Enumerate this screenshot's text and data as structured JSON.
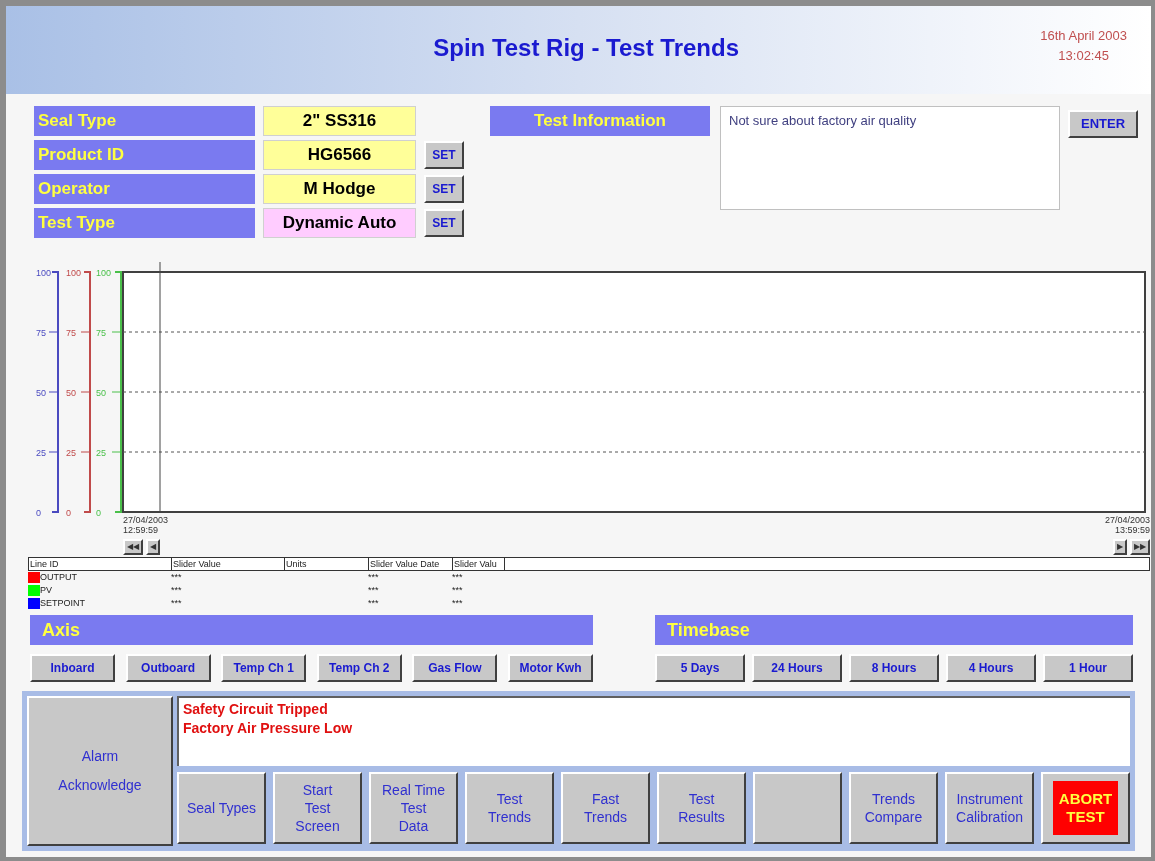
{
  "header": {
    "title": "Spin Test Rig - Test Trends",
    "date": "16th April 2003",
    "time": "13:02:45"
  },
  "fields": [
    {
      "label": "Seal Type",
      "value": "2\" SS316",
      "kind": "normal"
    },
    {
      "label": "Product ID",
      "value": "HG6566",
      "kind": "normal",
      "button": "SET"
    },
    {
      "label": "Operator",
      "value": "M Hodge",
      "kind": "normal",
      "button": "SET"
    },
    {
      "label": "Test Type",
      "value": "Dynamic Auto",
      "kind": "special",
      "button": "SET"
    }
  ],
  "test_information": {
    "label": "Test Information",
    "value": "Not sure about factory air quality",
    "button": "ENTER"
  },
  "trend_chart": {
    "axes": [
      {
        "color": "#4a4ac0",
        "ticks": [
          "100",
          "75",
          "50",
          "25",
          "0"
        ]
      },
      {
        "color": "#c04a4a",
        "ticks": [
          "100",
          "75",
          "50",
          "25",
          "0"
        ]
      },
      {
        "color": "#4ac04a",
        "ticks": [
          "100",
          "75",
          "50",
          "25",
          "0"
        ]
      }
    ],
    "start": {
      "date": "27/04/2003",
      "time": "12:59:59"
    },
    "end": {
      "date": "27/04/2003",
      "time": "13:59:59"
    },
    "nav_left": [
      "◀◀",
      "◀"
    ],
    "nav_right": [
      "▶",
      "▶▶"
    ]
  },
  "legend": {
    "columns": [
      "Line ID",
      "Slider Value",
      "Units",
      "Slider Value Date",
      "Slider Valu"
    ],
    "rows": [
      {
        "name": "OUTPUT",
        "color": "#ff0000",
        "slider_value": "***",
        "slider_value_date": "***",
        "column_5": "***"
      },
      {
        "name": "PV",
        "color": "#00ff00",
        "slider_value": "***",
        "slider_value_date": "***",
        "column_5": "***"
      },
      {
        "name": "SETPOINT",
        "color": "#0000ff",
        "slider_value": "***",
        "slider_value_date": "***",
        "column_5": "***"
      }
    ]
  },
  "axis_panel": {
    "title": "Axis",
    "buttons": [
      "Inboard",
      "Outboard",
      "Temp Ch 1",
      "Temp Ch 2",
      "Gas Flow",
      "Motor Kwh"
    ]
  },
  "timebase_panel": {
    "title": "Timebase",
    "buttons": [
      "5 Days",
      "24 Hours",
      "8 Hours",
      "4 Hours",
      "1 Hour"
    ]
  },
  "alarm_button": {
    "lines": [
      "Alarm",
      "Acknowledge"
    ]
  },
  "alarms": [
    "Safety Circuit Tripped",
    "Factory Air Pressure Low"
  ],
  "nav_buttons": [
    {
      "kind": "normal",
      "lines": [
        "Seal Types"
      ]
    },
    {
      "kind": "normal",
      "lines": [
        "Start",
        "Test",
        "Screen"
      ]
    },
    {
      "kind": "normal",
      "lines": [
        "Real Time",
        "Test",
        "Data"
      ]
    },
    {
      "kind": "normal",
      "lines": [
        "Test",
        "Trends"
      ]
    },
    {
      "kind": "normal",
      "lines": [
        "Fast",
        "Trends"
      ]
    },
    {
      "kind": "normal",
      "lines": [
        "Test",
        "Results"
      ]
    },
    {
      "kind": "blank"
    },
    {
      "kind": "normal",
      "lines": [
        "Trends",
        "Compare"
      ]
    },
    {
      "kind": "normal",
      "lines": [
        "Instrument",
        "Calibration"
      ]
    },
    {
      "kind": "abort",
      "lines": [
        "ABORT",
        "TEST"
      ]
    }
  ]
}
